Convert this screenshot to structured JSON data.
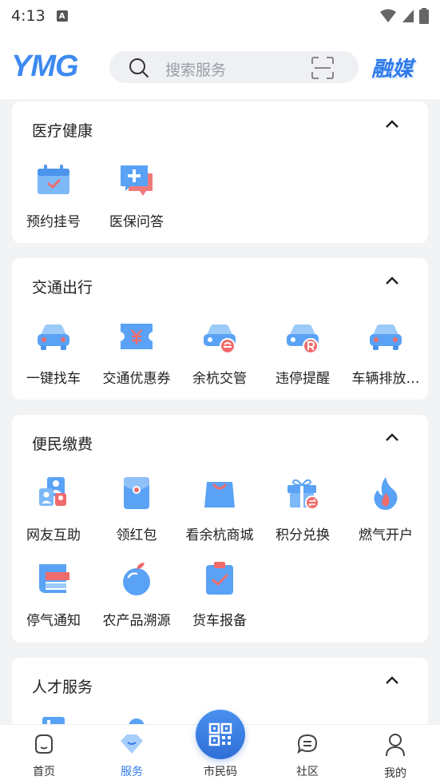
{
  "status_bar": {
    "time": "4:13",
    "notification_badge": "A"
  },
  "header": {
    "logo": "YMG",
    "search_placeholder": "搜索服务",
    "brand": "融媒"
  },
  "sections": [
    {
      "title": "医疗健康",
      "items": [
        {
          "label": "预约挂号",
          "icon": "calendar-check-icon"
        },
        {
          "label": "医保问答",
          "icon": "medical-chat-icon"
        }
      ]
    },
    {
      "title": "交通出行",
      "items": [
        {
          "label": "一键找车",
          "icon": "car-icon"
        },
        {
          "label": "交通优惠券",
          "icon": "ticket-coupon-icon"
        },
        {
          "label": "余杭交管",
          "icon": "police-car-icon"
        },
        {
          "label": "违停提醒",
          "icon": "parking-car-icon"
        },
        {
          "label": "车辆排放…",
          "icon": "car-emission-icon"
        }
      ]
    },
    {
      "title": "便民缴费",
      "items": [
        {
          "label": "网友互助",
          "icon": "people-help-icon"
        },
        {
          "label": "领红包",
          "icon": "red-packet-icon"
        },
        {
          "label": "看余杭商城",
          "icon": "shopping-bag-icon"
        },
        {
          "label": "积分兑换",
          "icon": "gift-exchange-icon"
        },
        {
          "label": "燃气开户",
          "icon": "flame-icon"
        },
        {
          "label": "停气通知",
          "icon": "notice-icon"
        },
        {
          "label": "农产品溯源",
          "icon": "apple-icon"
        },
        {
          "label": "货车报备",
          "icon": "clipboard-check-icon"
        }
      ]
    },
    {
      "title": "人才服务",
      "items": []
    }
  ],
  "tabbar": {
    "tabs": [
      {
        "label": "首页",
        "icon": "home-icon"
      },
      {
        "label": "服务",
        "icon": "service-diamond-icon"
      },
      {
        "label": "市民码",
        "icon": "qr-code-icon"
      },
      {
        "label": "社区",
        "icon": "community-chat-icon"
      },
      {
        "label": "我的",
        "icon": "profile-icon"
      }
    ],
    "active": "服务"
  },
  "colors": {
    "accent": "#2f7bea",
    "icon_blue": "#5aa2f5",
    "icon_red": "#f06b6b"
  }
}
